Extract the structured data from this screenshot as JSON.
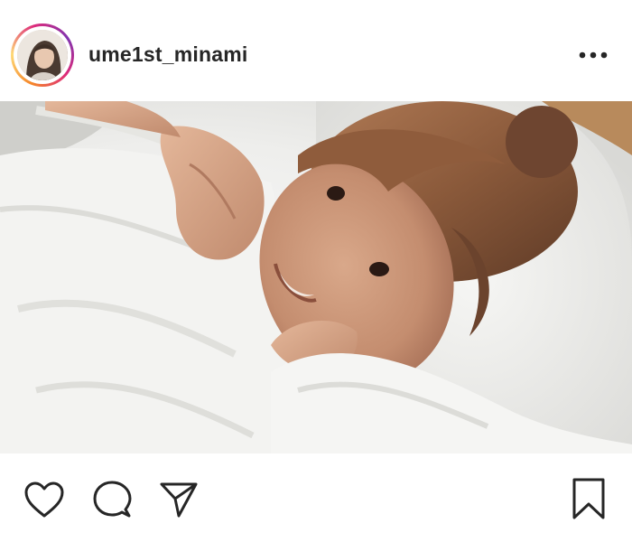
{
  "post": {
    "username": "ume1st_minami",
    "avatar_icon": "profile-avatar",
    "more_icon": "more-options-icon",
    "image": {
      "description_icon": "post-photo"
    },
    "actions": {
      "like_icon": "heart-icon",
      "comment_icon": "comment-icon",
      "share_icon": "paper-plane-icon",
      "save_icon": "bookmark-icon"
    }
  },
  "colors": {
    "text": "#262626",
    "story_ring": [
      "#f58529",
      "#feda77",
      "#dd2a7b",
      "#8134af"
    ],
    "background": "#ffffff"
  }
}
